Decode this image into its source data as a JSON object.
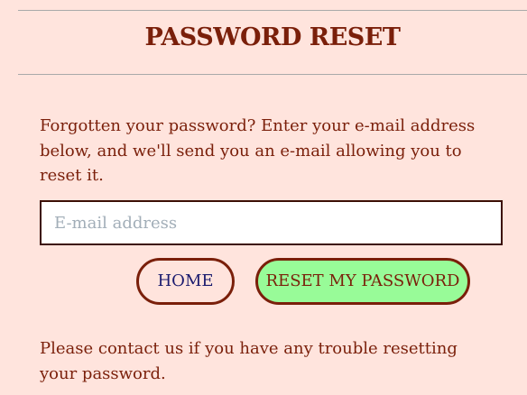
{
  "page": {
    "title": "PASSWORD RESET"
  },
  "form": {
    "intro_text": "Forgotten your password? Enter your e-mail address below, and we'll send you an e-mail allowing you to reset it.",
    "email_placeholder": "E-mail address",
    "email_value": "",
    "home_label": "HOME",
    "reset_label": "RESET MY PASSWORD"
  },
  "footer": {
    "contact_text": "Please contact us if you have any trouble resetting your password."
  },
  "colors": {
    "background": "#ffe4dd",
    "text": "#7a1f0a",
    "reset_button_bg": "#98fb98",
    "home_text": "#1a1a6e"
  }
}
